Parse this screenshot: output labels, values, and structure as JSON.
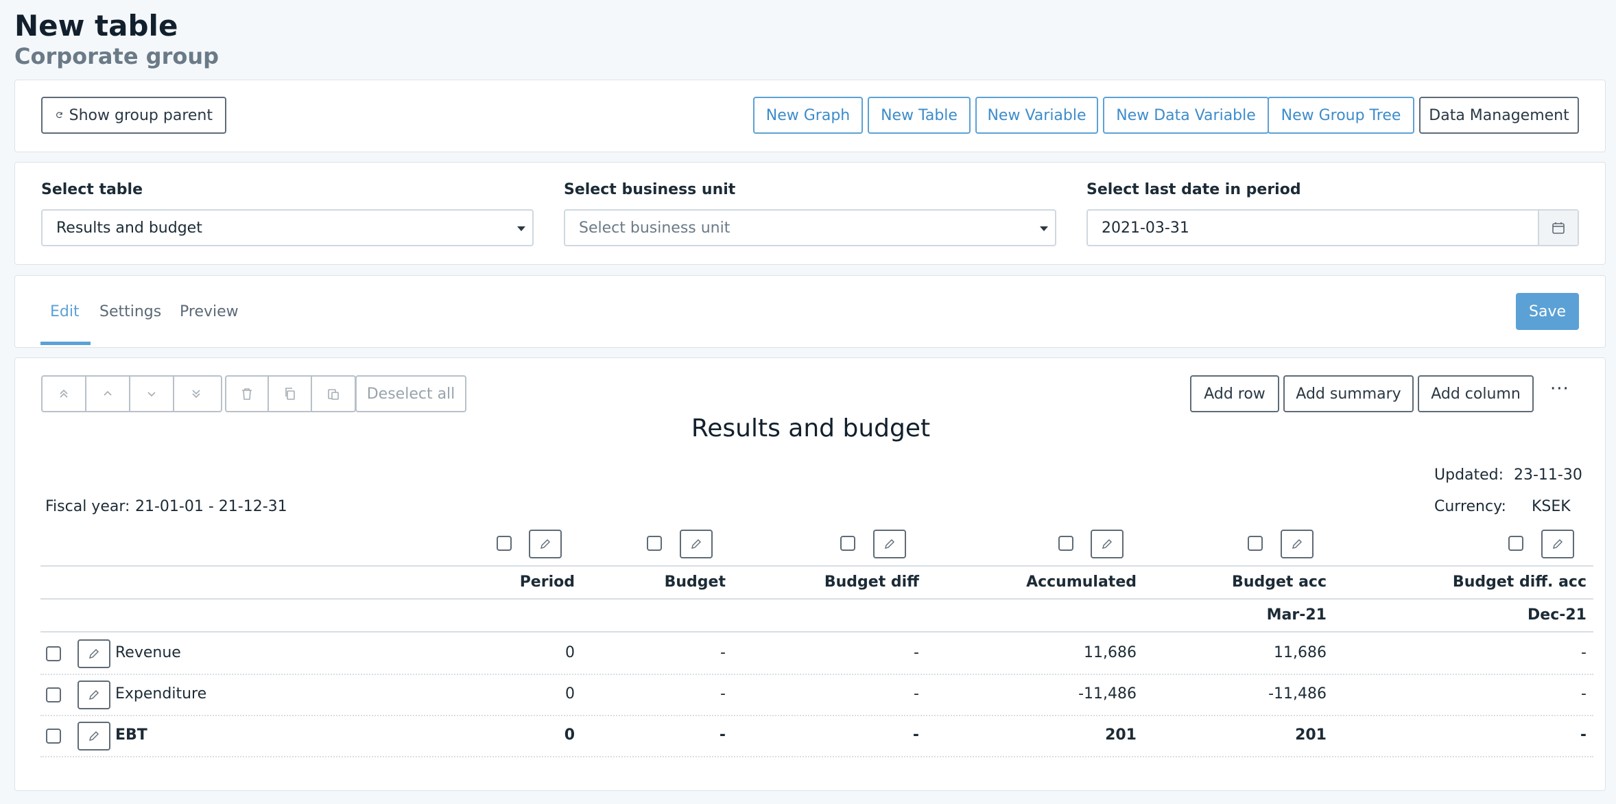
{
  "header": {
    "title": "New table",
    "subtitle": "Corporate group"
  },
  "toolbar": {
    "show_parent": "Show group parent",
    "new_graph": "New Graph",
    "new_table": "New Table",
    "new_variable": "New Variable",
    "new_data_variable": "New Data Variable",
    "new_group_tree": "New Group Tree",
    "data_management": "Data Management"
  },
  "selects": {
    "table_label": "Select table",
    "table_value": "Results and budget",
    "unit_label": "Select business unit",
    "unit_placeholder": "Select business unit",
    "date_label": "Select last date in period",
    "date_value": "2021-03-31"
  },
  "tabs": {
    "edit": "Edit",
    "settings": "Settings",
    "preview": "Preview",
    "save": "Save"
  },
  "editor": {
    "deselect_all": "Deselect all",
    "add_row": "Add row",
    "add_summary": "Add summary",
    "add_column": "Add column",
    "more": "···"
  },
  "table": {
    "title": "Results and budget",
    "updated_label": "Updated:",
    "updated_value": "23-11-30",
    "currency_label": "Currency:",
    "currency_value": "KSEK",
    "fiscal_label": "Fiscal year:",
    "fiscal_value": "21-01-01 - 21-12-31",
    "columns": [
      {
        "label": "Period",
        "sub": ""
      },
      {
        "label": "Budget",
        "sub": ""
      },
      {
        "label": "Budget diff",
        "sub": ""
      },
      {
        "label": "Accumulated",
        "sub": ""
      },
      {
        "label": "Budget acc",
        "sub": "Mar-21"
      },
      {
        "label": "Budget diff. acc",
        "sub": "Dec-21"
      }
    ],
    "rows": [
      {
        "label": "Revenue",
        "values": [
          "0",
          "-",
          "-",
          "11,686",
          "11,686",
          "-"
        ]
      },
      {
        "label": "Expenditure",
        "values": [
          "0",
          "-",
          "-",
          "-11,486",
          "-11,486",
          "-"
        ]
      },
      {
        "label": "EBT",
        "values": [
          "0",
          "-",
          "-",
          "201",
          "201",
          "-"
        ]
      }
    ]
  },
  "colors": {
    "accent": "#5ba1d6",
    "border_dark": "#5f6b76"
  }
}
